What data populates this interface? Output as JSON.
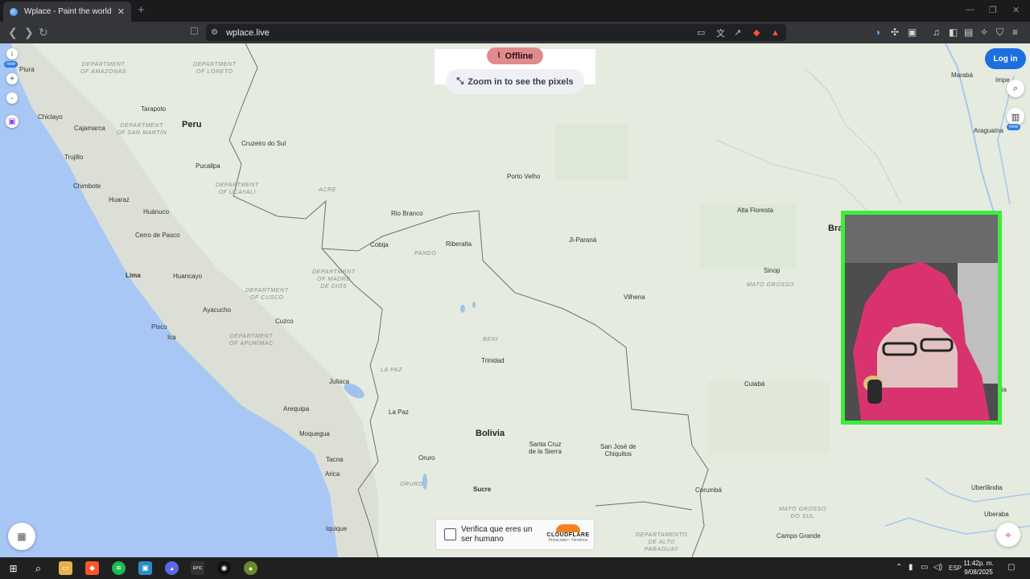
{
  "browser": {
    "tab_title": "Wplace - Paint the world",
    "tab_close": "✕",
    "new_tab": "+",
    "url": "wplace.live"
  },
  "map": {
    "top_left_badge": "new",
    "offline_label": "Offline",
    "zoom_hint": "Zoom in to see the pixels",
    "login_label": "Log in",
    "right_badge": "new",
    "countries": [
      {
        "id": "peru",
        "name": "Peru"
      },
      {
        "id": "bolivia",
        "name": "Bolivia"
      },
      {
        "id": "brazil",
        "name": "Bra"
      }
    ],
    "regions": [
      {
        "id": "amazonas",
        "name": "DEPARTMENT\nOF AMAZONAS"
      },
      {
        "id": "loreto",
        "name": "DEPARTMENT\nOF LORETO"
      },
      {
        "id": "san-martin",
        "name": "DEPARTMENT\nOF SAN MARTÍN"
      },
      {
        "id": "ucayali",
        "name": "DEPARTMENT\nOF UCAYALI"
      },
      {
        "id": "acre",
        "name": "ACRE"
      },
      {
        "id": "pando",
        "name": "PANDO"
      },
      {
        "id": "madre-de-dios",
        "name": "DEPARTMENT\nOF MADRE\nDE DIOS"
      },
      {
        "id": "cusco",
        "name": "DEPARTMENT\nOF CUSCO"
      },
      {
        "id": "apurimac",
        "name": "DEPARTMENT\nOF APURÍMAC"
      },
      {
        "id": "beni",
        "name": "BENI"
      },
      {
        "id": "la-paz-dept",
        "name": "LA PAZ"
      },
      {
        "id": "oruro-dept",
        "name": "ORURO"
      },
      {
        "id": "mato-grosso",
        "name": "MATO GROSSO"
      },
      {
        "id": "mato-grosso-sul",
        "name": "MATO GROSSO\nDO SUL"
      },
      {
        "id": "alto-paraguay",
        "name": "DEPARTAMENTO\nDE ALTO\nPARAGUAY"
      }
    ],
    "cities": [
      {
        "id": "piura",
        "name": "Piura"
      },
      {
        "id": "chiclayo",
        "name": "Chiclayo"
      },
      {
        "id": "tarapoto",
        "name": "Tarapoto"
      },
      {
        "id": "cajamarca",
        "name": "Cajamarca"
      },
      {
        "id": "trujillo",
        "name": "Trujillo"
      },
      {
        "id": "cruzeiro",
        "name": "Cruzeiro do Sul"
      },
      {
        "id": "pucallpa",
        "name": "Pucallpa"
      },
      {
        "id": "chimbote",
        "name": "Chimbote"
      },
      {
        "id": "huaraz",
        "name": "Huaraz"
      },
      {
        "id": "huanuco",
        "name": "Huánuco"
      },
      {
        "id": "cerro",
        "name": "Cerro de Pasco"
      },
      {
        "id": "lima",
        "name": "Lima"
      },
      {
        "id": "huancayo",
        "name": "Huancayo"
      },
      {
        "id": "ayacucho",
        "name": "Ayacucho"
      },
      {
        "id": "cuzco",
        "name": "Cuzco"
      },
      {
        "id": "pisco",
        "name": "Pisco"
      },
      {
        "id": "ica",
        "name": "Ica"
      },
      {
        "id": "juliaca",
        "name": "Juliaca"
      },
      {
        "id": "arequipa",
        "name": "Arequipa"
      },
      {
        "id": "moquegua",
        "name": "Moquegua"
      },
      {
        "id": "tacna",
        "name": "Tacna"
      },
      {
        "id": "arica",
        "name": "Arica"
      },
      {
        "id": "iquique",
        "name": "Iquique"
      },
      {
        "id": "rio-branco",
        "name": "Rio Branco"
      },
      {
        "id": "cobija",
        "name": "Cobija"
      },
      {
        "id": "riberalta",
        "name": "Riberalta"
      },
      {
        "id": "porto-velho",
        "name": "Porto Velho"
      },
      {
        "id": "ji-parana",
        "name": "Ji-Paraná"
      },
      {
        "id": "vilhena",
        "name": "Vilhena"
      },
      {
        "id": "trinidad",
        "name": "Trinidad"
      },
      {
        "id": "la-paz",
        "name": "La Paz"
      },
      {
        "id": "oruro",
        "name": "Oruro"
      },
      {
        "id": "sucre",
        "name": "Sucre"
      },
      {
        "id": "santa-cruz",
        "name": "Santa Cruz\nde la Sierra"
      },
      {
        "id": "san-jose",
        "name": "San José de\nChiquitos"
      },
      {
        "id": "alta-floresta",
        "name": "Alta Floresta"
      },
      {
        "id": "sinop",
        "name": "Sinop"
      },
      {
        "id": "cuiaba",
        "name": "Cuiabá"
      },
      {
        "id": "corumba",
        "name": "Corumbá"
      },
      {
        "id": "campo-grande",
        "name": "Campo Grande"
      },
      {
        "id": "maraba",
        "name": "Marabá"
      },
      {
        "id": "imperatriz",
        "name": "Impe"
      },
      {
        "id": "araguaina",
        "name": "Araguaína"
      },
      {
        "id": "uberlandia",
        "name": "Uberlândia"
      },
      {
        "id": "uberaba",
        "name": "Uberaba"
      },
      {
        "id": "brasilia",
        "name": "lia"
      }
    ]
  },
  "captcha": {
    "text": "Verifica que eres un ser humano",
    "brand": "CLOUDFLARE",
    "links": "Privacidad • Términos"
  },
  "taskbar": {
    "language": "ESP",
    "time": "11:42p. m.",
    "date": "9/08/2025"
  },
  "colors": {
    "ocean": "#a9c7f5",
    "land": "#e6ebe0",
    "webcam_border": "#3ded3a",
    "offline_pill": "#e08a8e",
    "login": "#1d6fe0"
  }
}
